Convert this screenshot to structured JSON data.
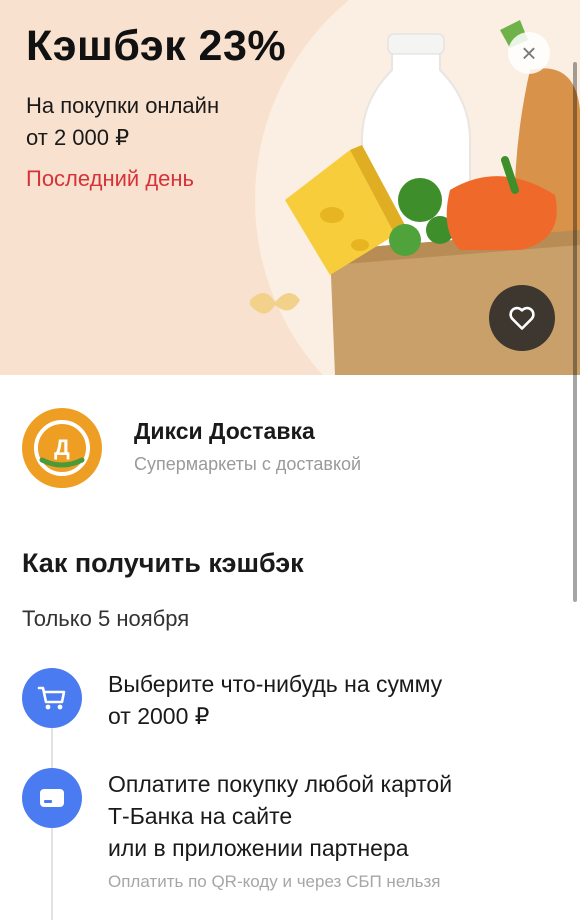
{
  "banner": {
    "title": "Кэшбэк 23%",
    "subtitle_line1": "На покупки онлайн",
    "subtitle_line2": "от 2 000 ₽",
    "deadline": "Последний день",
    "close_label": "×"
  },
  "merchant": {
    "logo_letter": "Д",
    "name": "Дикси Доставка",
    "category": "Супермаркеты с доставкой"
  },
  "how_to": {
    "title": "Как получить кэшбэк",
    "date_note": "Только 5 ноября",
    "steps": [
      {
        "icon": "cart-icon",
        "line1": "Выберите что-нибудь на сумму",
        "line2": "от 2000 ₽"
      },
      {
        "icon": "card-icon",
        "line1": "Оплатите покупку любой картой",
        "line2": "Т-Банка на сайте",
        "line3": "или в приложении партнера",
        "note": "Оплатить по QR-коду и через СБП нельзя"
      }
    ]
  },
  "colors": {
    "banner_bg": "#f8e2cf",
    "deadline_red": "#d6323a",
    "step_blue": "#4b7bf0",
    "logo_orange": "#ee9e23"
  }
}
